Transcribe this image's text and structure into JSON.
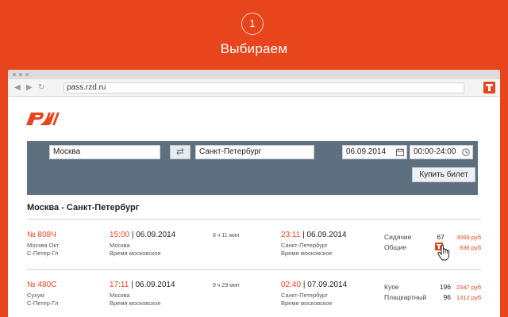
{
  "step": {
    "number": "1",
    "title": "Выбираем"
  },
  "browser": {
    "url": "pass.rzd.ru"
  },
  "search": {
    "from": "Москва",
    "to": "Санкт-Петербург",
    "date": "06.09.2014",
    "time": "00:00-24:00",
    "buy_label": "Купить билет"
  },
  "route_title": "Москва - Санкт-Петербург",
  "trains": [
    {
      "number": "№ 808Ч",
      "from_station": "Москва Окт",
      "to_station": "С-Петер-Гл",
      "dep_time": "15:00",
      "dep_date": "| 06.09.2014",
      "dep_station": "Москва",
      "dep_tz": "Время московское",
      "duration": "8 ч 11 мин",
      "arr_time": "23:11",
      "arr_date": "| 06.09.2014",
      "arr_station": "Санкт-Петербург",
      "arr_tz": "Время московское",
      "classes": [
        {
          "name": "Сидячие",
          "count": "67",
          "price": "3069 руб"
        },
        {
          "name": "Общие",
          "count": "",
          "price": "836 руб"
        }
      ]
    },
    {
      "number": "№ 480С",
      "from_station": "Сухум",
      "to_station": "С-Петер-Гл",
      "dep_time": "17:11",
      "dep_date": "| 06.09.2014",
      "dep_station": "Москва",
      "dep_tz": "Время московское",
      "duration": "9 ч 29 мин",
      "arr_time": "02:40",
      "arr_date": "| 07.09.2014",
      "arr_station": "Санкт-Петербург",
      "arr_tz": "Время московское",
      "classes": [
        {
          "name": "Купе",
          "count": "196",
          "price": "2347 руб"
        },
        {
          "name": "Плацкартный",
          "count": "96",
          "price": "1312 руб"
        }
      ]
    }
  ],
  "colors": {
    "accent": "#e8451c",
    "panel": "#5e6f7f"
  },
  "icons": [
    "back-icon",
    "forward-icon",
    "reload-icon",
    "calendar-icon",
    "clock-icon",
    "swap-icon",
    "extension-t-icon",
    "hand-cursor-icon"
  ]
}
